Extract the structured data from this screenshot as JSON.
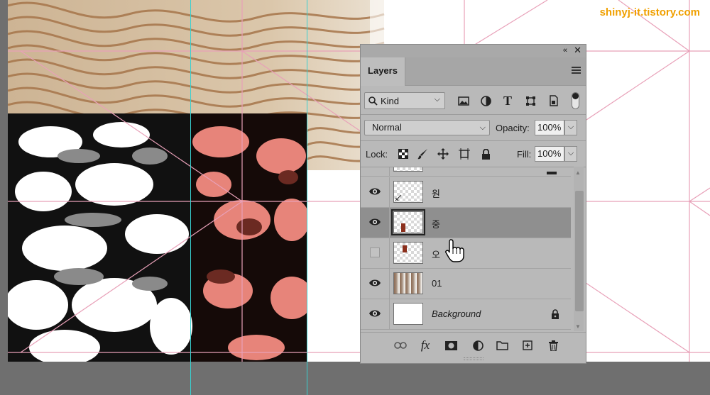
{
  "watermark": "shinyj-it.tistory.com",
  "colors": {
    "guide": "#39d0d0",
    "grid": "#e8a0b8",
    "watermark": "#f0a000",
    "panel_bg": "#b9b9b9",
    "selected_row": "#8f8f8f"
  },
  "panel": {
    "tab_label": "Layers",
    "filter": {
      "kind_label": "Kind",
      "icons": [
        "image-filter-icon",
        "adjustment-filter-icon",
        "type-filter-icon",
        "shape-filter-icon",
        "smart-object-filter-icon"
      ]
    },
    "blend": {
      "mode": "Normal",
      "opacity_label": "Opacity:",
      "opacity_value": "100%"
    },
    "lock": {
      "label": "Lock:",
      "fill_label": "Fill:",
      "fill_value": "100%"
    },
    "layers": [
      {
        "name": "원",
        "visible": true,
        "selected": false,
        "thumb": "transparent-with-mark",
        "italic": false,
        "locked": false
      },
      {
        "name": "중",
        "visible": true,
        "selected": true,
        "thumb": "transparent-with-mark",
        "italic": false,
        "locked": false
      },
      {
        "name": "오",
        "visible": false,
        "selected": false,
        "thumb": "transparent-with-mark",
        "italic": false,
        "locked": false
      },
      {
        "name": "01",
        "visible": true,
        "selected": false,
        "thumb": "photo",
        "italic": false,
        "locked": false
      },
      {
        "name": "Background",
        "visible": true,
        "selected": false,
        "thumb": "white",
        "italic": true,
        "locked": true
      }
    ]
  }
}
